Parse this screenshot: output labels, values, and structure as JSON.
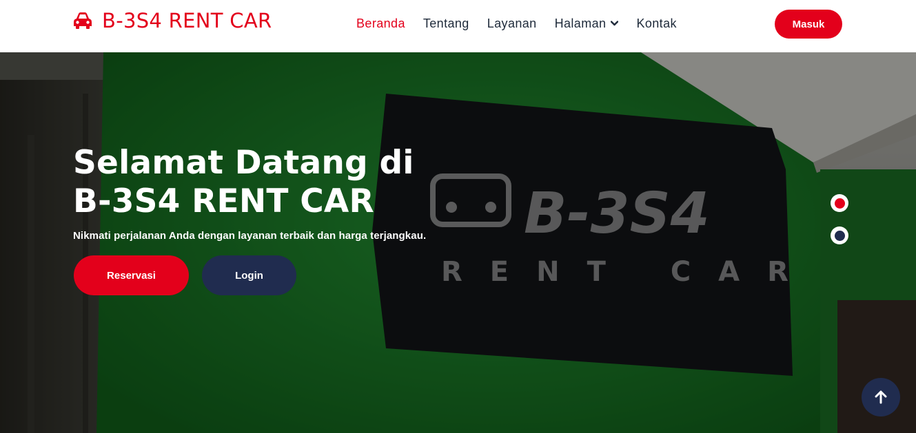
{
  "navbar": {
    "brand": "B-3S4 RENT CAR",
    "brand_icon": "car-icon",
    "links": [
      {
        "label": "Beranda",
        "active": true
      },
      {
        "label": "Tentang",
        "active": false
      },
      {
        "label": "Layanan",
        "active": false
      },
      {
        "label": "Halaman",
        "active": false,
        "dropdown": true
      },
      {
        "label": "Kontak",
        "active": false
      }
    ],
    "login_button": "Masuk"
  },
  "hero": {
    "title_line1": "Selamat Datang di",
    "title_line2": "B-3S4 RENT CAR",
    "subtitle": "Nikmati perjalanan Anda dengan layanan terbaik dan harga terjangkau.",
    "reservasi_button": "Reservasi",
    "login_button": "Login",
    "sign_text_top": "B-3S4",
    "sign_text_bottom": "RENT CAR",
    "carousel": {
      "slides": 2,
      "active_index": 0
    }
  },
  "scroll_top_icon": "arrow-up-icon",
  "colors": {
    "primary": "#e3001b",
    "secondary": "#202c4f",
    "nav_text": "#1e2a3a",
    "wall_green": "#1f8a2c"
  }
}
